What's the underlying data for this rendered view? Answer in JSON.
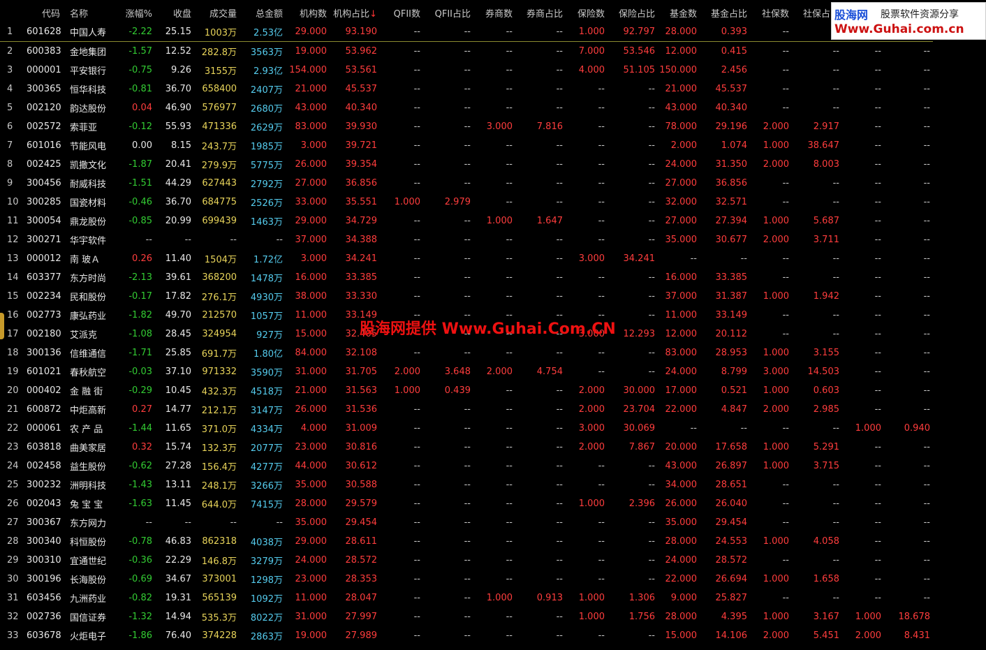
{
  "table": {
    "headers": [
      "",
      "代码",
      "名称",
      "涨幅%",
      "收盘",
      "成交量",
      "总金额",
      "机构数",
      "机构占比",
      "QFII数",
      "QFII占比",
      "券商数",
      "券商占比",
      "保险数",
      "保险占比",
      "基金数",
      "基金占比",
      "社保数",
      "社保占比",
      "",
      ""
    ],
    "sort_indicator": "↓",
    "rows": [
      [
        "1",
        "601628",
        "中国人寿",
        "-2.22",
        "25.15",
        "1003万",
        "2.53亿",
        "29.000",
        "93.190",
        "--",
        "--",
        "--",
        "--",
        "1.000",
        "92.797",
        "28.000",
        "0.393",
        "--",
        "--",
        "--",
        "--"
      ],
      [
        "2",
        "600383",
        "金地集团",
        "-1.57",
        "12.52",
        "282.8万",
        "3563万",
        "19.000",
        "53.962",
        "--",
        "--",
        "--",
        "--",
        "7.000",
        "53.546",
        "12.000",
        "0.415",
        "--",
        "--",
        "--",
        "--"
      ],
      [
        "3",
        "000001",
        "平安银行",
        "-0.75",
        "9.26",
        "3155万",
        "2.93亿",
        "154.000",
        "53.561",
        "--",
        "--",
        "--",
        "--",
        "4.000",
        "51.105",
        "150.000",
        "2.456",
        "--",
        "--",
        "--",
        "--"
      ],
      [
        "4",
        "300365",
        "恒华科技",
        "-0.81",
        "36.70",
        "658400",
        "2407万",
        "21.000",
        "45.537",
        "--",
        "--",
        "--",
        "--",
        "--",
        "--",
        "21.000",
        "45.537",
        "--",
        "--",
        "--",
        "--"
      ],
      [
        "5",
        "002120",
        "韵达股份",
        "0.04",
        "46.90",
        "576977",
        "2680万",
        "43.000",
        "40.340",
        "--",
        "--",
        "--",
        "--",
        "--",
        "--",
        "43.000",
        "40.340",
        "--",
        "--",
        "--",
        "--"
      ],
      [
        "6",
        "002572",
        "索菲亚",
        "-0.12",
        "55.93",
        "471336",
        "2629万",
        "83.000",
        "39.930",
        "--",
        "--",
        "3.000",
        "7.816",
        "--",
        "--",
        "78.000",
        "29.196",
        "2.000",
        "2.917",
        "--",
        "--"
      ],
      [
        "7",
        "601016",
        "节能风电",
        "0.00",
        "8.15",
        "243.7万",
        "1985万",
        "3.000",
        "39.721",
        "--",
        "--",
        "--",
        "--",
        "--",
        "--",
        "2.000",
        "1.074",
        "1.000",
        "38.647",
        "--",
        "--"
      ],
      [
        "8",
        "002425",
        "凯撒文化",
        "-1.87",
        "20.41",
        "279.9万",
        "5775万",
        "26.000",
        "39.354",
        "--",
        "--",
        "--",
        "--",
        "--",
        "--",
        "24.000",
        "31.350",
        "2.000",
        "8.003",
        "--",
        "--"
      ],
      [
        "9",
        "300456",
        "耐威科技",
        "-1.51",
        "44.29",
        "627443",
        "2792万",
        "27.000",
        "36.856",
        "--",
        "--",
        "--",
        "--",
        "--",
        "--",
        "27.000",
        "36.856",
        "--",
        "--",
        "--",
        "--"
      ],
      [
        "10",
        "300285",
        "国瓷材料",
        "-0.46",
        "36.70",
        "684775",
        "2526万",
        "33.000",
        "35.551",
        "1.000",
        "2.979",
        "--",
        "--",
        "--",
        "--",
        "32.000",
        "32.571",
        "--",
        "--",
        "--",
        "--"
      ],
      [
        "11",
        "300054",
        "鼎龙股份",
        "-0.85",
        "20.99",
        "699439",
        "1463万",
        "29.000",
        "34.729",
        "--",
        "--",
        "1.000",
        "1.647",
        "--",
        "--",
        "27.000",
        "27.394",
        "1.000",
        "5.687",
        "--",
        "--"
      ],
      [
        "12",
        "300271",
        "华宇软件",
        "--",
        "--",
        "--",
        "--",
        "37.000",
        "34.388",
        "--",
        "--",
        "--",
        "--",
        "--",
        "--",
        "35.000",
        "30.677",
        "2.000",
        "3.711",
        "--",
        "--"
      ],
      [
        "13",
        "000012",
        "南 玻Ａ",
        "0.26",
        "11.40",
        "1504万",
        "1.72亿",
        "3.000",
        "34.241",
        "--",
        "--",
        "--",
        "--",
        "3.000",
        "34.241",
        "--",
        "--",
        "--",
        "--",
        "--",
        "--"
      ],
      [
        "14",
        "603377",
        "东方时尚",
        "-2.13",
        "39.61",
        "368200",
        "1478万",
        "16.000",
        "33.385",
        "--",
        "--",
        "--",
        "--",
        "--",
        "--",
        "16.000",
        "33.385",
        "--",
        "--",
        "--",
        "--"
      ],
      [
        "15",
        "002234",
        "民和股份",
        "-0.17",
        "17.82",
        "276.1万",
        "4930万",
        "38.000",
        "33.330",
        "--",
        "--",
        "--",
        "--",
        "--",
        "--",
        "37.000",
        "31.387",
        "1.000",
        "1.942",
        "--",
        "--"
      ],
      [
        "16",
        "002773",
        "康弘药业",
        "-1.82",
        "49.70",
        "212570",
        "1057万",
        "11.000",
        "33.149",
        "--",
        "--",
        "--",
        "--",
        "--",
        "--",
        "11.000",
        "33.149",
        "--",
        "--",
        "--",
        "--"
      ],
      [
        "17",
        "002180",
        "艾派克",
        "-1.08",
        "28.45",
        "324954",
        "927万",
        "15.000",
        "32.405",
        "--",
        "--",
        "--",
        "--",
        "3.000",
        "12.293",
        "12.000",
        "20.112",
        "--",
        "--",
        "--",
        "--"
      ],
      [
        "18",
        "300136",
        "信维通信",
        "-1.71",
        "25.85",
        "691.7万",
        "1.80亿",
        "84.000",
        "32.108",
        "--",
        "--",
        "--",
        "--",
        "--",
        "--",
        "83.000",
        "28.953",
        "1.000",
        "3.155",
        "--",
        "--"
      ],
      [
        "19",
        "601021",
        "春秋航空",
        "-0.03",
        "37.10",
        "971332",
        "3590万",
        "31.000",
        "31.705",
        "2.000",
        "3.648",
        "2.000",
        "4.754",
        "--",
        "--",
        "24.000",
        "8.799",
        "3.000",
        "14.503",
        "--",
        "--"
      ],
      [
        "20",
        "000402",
        "金 融 街",
        "-0.29",
        "10.45",
        "432.3万",
        "4518万",
        "21.000",
        "31.563",
        "1.000",
        "0.439",
        "--",
        "--",
        "2.000",
        "30.000",
        "17.000",
        "0.521",
        "1.000",
        "0.603",
        "--",
        "--"
      ],
      [
        "21",
        "600872",
        "中炬高新",
        "0.27",
        "14.77",
        "212.1万",
        "3147万",
        "26.000",
        "31.536",
        "--",
        "--",
        "--",
        "--",
        "2.000",
        "23.704",
        "22.000",
        "4.847",
        "2.000",
        "2.985",
        "--",
        "--"
      ],
      [
        "22",
        "000061",
        "农 产 品",
        "-1.44",
        "11.65",
        "371.0万",
        "4334万",
        "4.000",
        "31.009",
        "--",
        "--",
        "--",
        "--",
        "3.000",
        "30.069",
        "--",
        "--",
        "--",
        "--",
        "1.000",
        "0.940"
      ],
      [
        "23",
        "603818",
        "曲美家居",
        "0.32",
        "15.74",
        "132.3万",
        "2077万",
        "23.000",
        "30.816",
        "--",
        "--",
        "--",
        "--",
        "2.000",
        "7.867",
        "20.000",
        "17.658",
        "1.000",
        "5.291",
        "--",
        "--"
      ],
      [
        "24",
        "002458",
        "益生股份",
        "-0.62",
        "27.28",
        "156.4万",
        "4277万",
        "44.000",
        "30.612",
        "--",
        "--",
        "--",
        "--",
        "--",
        "--",
        "43.000",
        "26.897",
        "1.000",
        "3.715",
        "--",
        "--"
      ],
      [
        "25",
        "300232",
        "洲明科技",
        "-1.43",
        "13.11",
        "248.1万",
        "3266万",
        "35.000",
        "30.588",
        "--",
        "--",
        "--",
        "--",
        "--",
        "--",
        "34.000",
        "28.651",
        "--",
        "--",
        "--",
        "--"
      ],
      [
        "26",
        "002043",
        "兔 宝 宝",
        "-1.63",
        "11.45",
        "644.0万",
        "7415万",
        "28.000",
        "29.579",
        "--",
        "--",
        "--",
        "--",
        "1.000",
        "2.396",
        "26.000",
        "26.040",
        "--",
        "--",
        "--",
        "--"
      ],
      [
        "27",
        "300367",
        "东方网力",
        "--",
        "--",
        "--",
        "--",
        "35.000",
        "29.454",
        "--",
        "--",
        "--",
        "--",
        "--",
        "--",
        "35.000",
        "29.454",
        "--",
        "--",
        "--",
        "--"
      ],
      [
        "28",
        "300340",
        "科恒股份",
        "-0.78",
        "46.83",
        "862318",
        "4038万",
        "29.000",
        "28.611",
        "--",
        "--",
        "--",
        "--",
        "--",
        "--",
        "28.000",
        "24.553",
        "1.000",
        "4.058",
        "--",
        "--"
      ],
      [
        "29",
        "300310",
        "宜通世纪",
        "-0.36",
        "22.29",
        "146.8万",
        "3279万",
        "24.000",
        "28.572",
        "--",
        "--",
        "--",
        "--",
        "--",
        "--",
        "24.000",
        "28.572",
        "--",
        "--",
        "--",
        "--"
      ],
      [
        "30",
        "300196",
        "长海股份",
        "-0.69",
        "34.67",
        "373001",
        "1298万",
        "23.000",
        "28.353",
        "--",
        "--",
        "--",
        "--",
        "--",
        "--",
        "22.000",
        "26.694",
        "1.000",
        "1.658",
        "--",
        "--"
      ],
      [
        "31",
        "603456",
        "九洲药业",
        "-0.82",
        "19.31",
        "565139",
        "1092万",
        "11.000",
        "28.047",
        "--",
        "--",
        "1.000",
        "0.913",
        "1.000",
        "1.306",
        "9.000",
        "25.827",
        "--",
        "--",
        "--",
        "--"
      ],
      [
        "32",
        "002736",
        "国信证券",
        "-1.32",
        "14.94",
        "535.3万",
        "8022万",
        "31.000",
        "27.997",
        "--",
        "--",
        "--",
        "--",
        "1.000",
        "1.756",
        "28.000",
        "4.395",
        "1.000",
        "3.167",
        "1.000",
        "18.678"
      ],
      [
        "33",
        "603678",
        "火炬电子",
        "-1.86",
        "76.40",
        "374228",
        "2863万",
        "19.000",
        "27.989",
        "--",
        "--",
        "--",
        "--",
        "--",
        "--",
        "15.000",
        "14.106",
        "2.000",
        "5.451",
        "2.000",
        "8.431"
      ]
    ]
  },
  "logo": {
    "brand": "股海网",
    "tagline": "股票软件资源分享",
    "url": "Www.Guhai.com.cn"
  },
  "watermark": "股海网提供 Www.Guhai.Com.CN",
  "colors": {
    "up": "#ff3d3d",
    "down": "#33cc33",
    "volume": "#e8d45a",
    "amount": "#55ccee",
    "background": "#000000"
  }
}
